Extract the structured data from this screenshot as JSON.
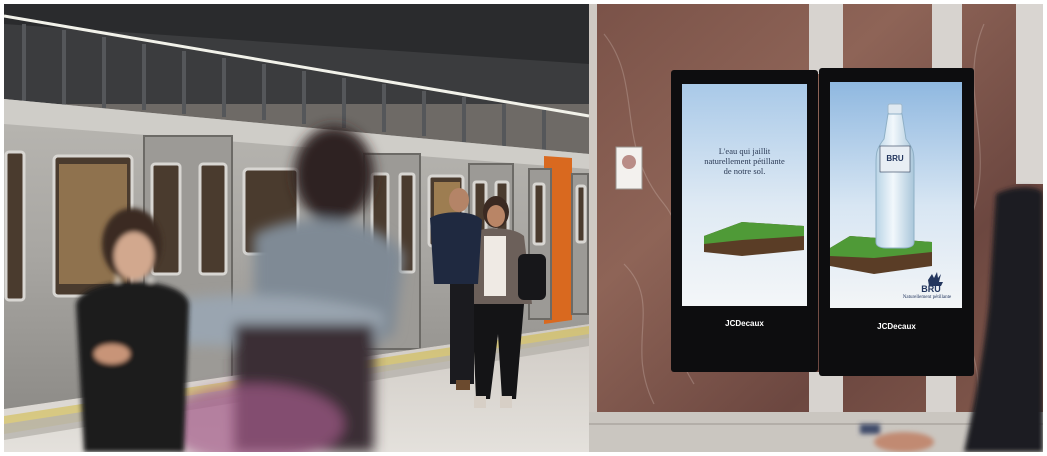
{
  "scene": {
    "left_ad": {
      "tagline_line1": "L'eau qui jaillit",
      "tagline_line2": "naturellement pétillante",
      "tagline_line3": "de notre sol."
    },
    "right_ad": {
      "bottle_label": "BRU",
      "logo_text": "BRU",
      "slogan": "Naturellement pétillante"
    },
    "left_panel_brand": "JCDecaux",
    "right_panel_brand": "JCDecaux"
  }
}
